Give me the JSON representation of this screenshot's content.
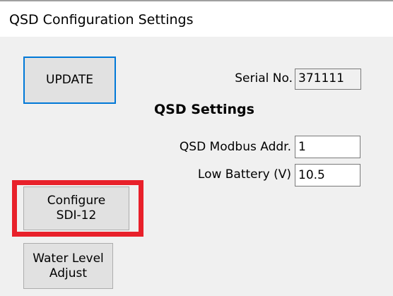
{
  "window": {
    "title": "QSD Configuration Settings"
  },
  "buttons": {
    "update": "UPDATE",
    "configure_sdi12": "Configure\nSDI-12",
    "water_level_adjust": "Water Level\nAdjust"
  },
  "serial": {
    "label": "Serial No.",
    "value": "371111"
  },
  "qsd_settings": {
    "heading": "QSD Settings",
    "modbus_addr_label": "QSD Modbus Addr.",
    "modbus_addr_value": "1",
    "low_battery_label": "Low Battery (V)",
    "low_battery_value": "10.5"
  },
  "colors": {
    "highlight": "#e8202a",
    "focus_border": "#0078d7",
    "panel_background": "#f0f0f0"
  }
}
